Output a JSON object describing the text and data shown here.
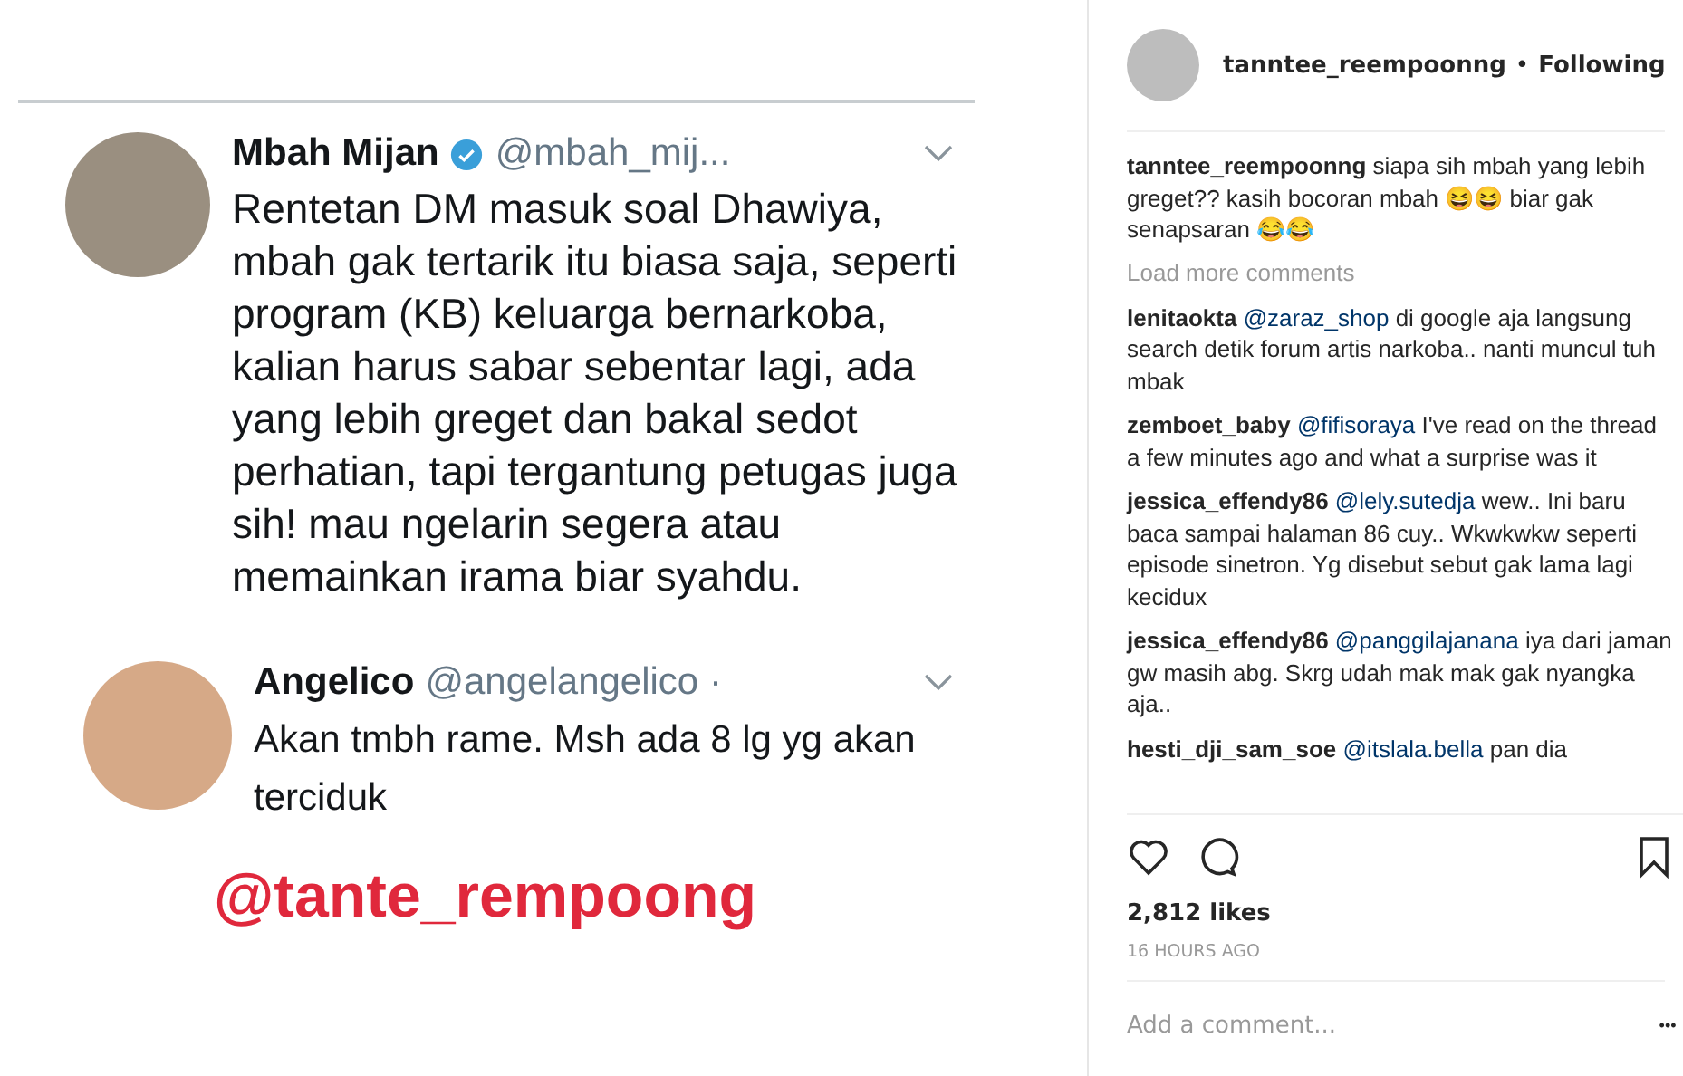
{
  "post_image": {
    "tweets": [
      {
        "name": "Mbah Mijan",
        "verified": true,
        "handle": "@mbah_mij...",
        "text": "Rentetan DM masuk soal Dhawiya, mbah gak tertarik itu biasa saja, seperti program (KB) keluarga bernarkoba, kalian harus sabar sebentar lagi, ada yang lebih greget dan bakal sedot perhatian, tapi tergantung petugas juga sih! mau ngelarin segera atau memainkan irama biar syahdu."
      },
      {
        "name": "Angelico",
        "handle": "@angelangelico ·",
        "text": "Akan tmbh rame. Msh ada 8 lg yg akan terciduk"
      }
    ],
    "sticker_text": "@tante_rempoong"
  },
  "header": {
    "username": "tanntee_reempoonng",
    "separator": "•",
    "follow_state": "Following"
  },
  "caption": {
    "username": "tanntee_reempoonng",
    "text": "siapa sih mbah yang lebih greget?? kasih bocoran mbah 😆😆 biar gak senapsaran 😂😂"
  },
  "load_more": "Load more comments",
  "comments": [
    {
      "username": "lenitaokta",
      "mention": "@zaraz_shop",
      "text": "di google aja langsung search detik forum artis narkoba.. nanti muncul tuh mbak"
    },
    {
      "username": "zemboet_baby",
      "mention": "@fifisoraya",
      "text": "I've read on the thread a few minutes ago and what a surprise was it"
    },
    {
      "username": "jessica_effendy86",
      "mention": "@lely.sutedja",
      "text": "wew.. Ini baru baca sampai halaman 86 cuy.. Wkwkwkw seperti episode sinetron. Yg disebut sebut gak lama lagi kecidux"
    },
    {
      "username": "jessica_effendy86",
      "mention": "@panggilajanana",
      "text": "iya dari jaman gw masih abg. Skrg udah mak mak gak nyangka aja.."
    },
    {
      "username": "hesti_dji_sam_soe",
      "mention": "@itslala.bella",
      "text": "pan dia"
    }
  ],
  "likes": "2,812 likes",
  "time": "16 HOURS AGO",
  "comment_box": {
    "placeholder": "Add a comment..."
  },
  "more_button": "•••"
}
